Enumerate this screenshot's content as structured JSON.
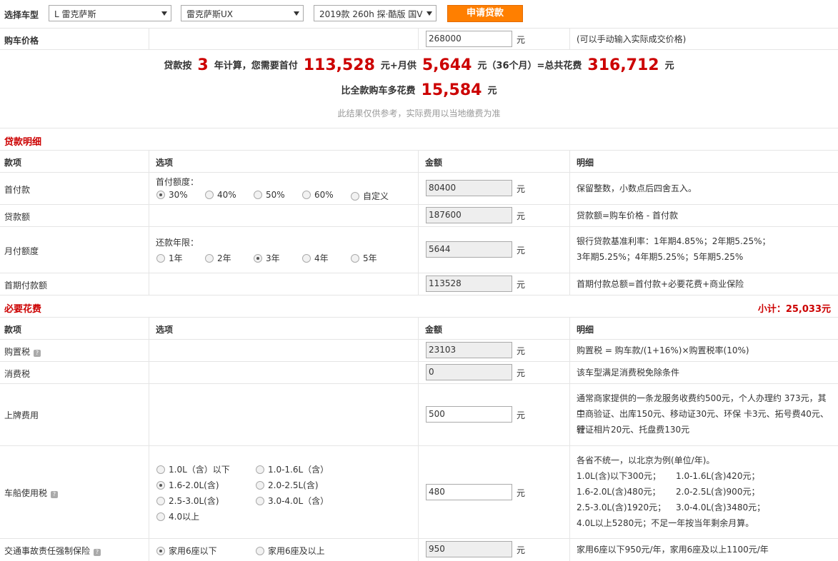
{
  "topbar": {
    "label": "选择车型",
    "brand": "L 雷克萨斯",
    "series": "雷克萨斯UX",
    "model": "2019款 260h 探·酷版 国V",
    "apply_button": "申请贷款"
  },
  "price_row": {
    "label": "购车价格",
    "value": "268000",
    "unit": "元",
    "hint": "(可以手动输入实际成交价格)"
  },
  "summary": {
    "p1": "贷款按",
    "years": "3",
    "p2": "年计算，您需要首付",
    "down": "113,528",
    "p3": "元+月供",
    "monthly": "5,644",
    "p4": "元（36个月）=总共花费",
    "total": "316,712",
    "p5": "元",
    "extra_label": "比全款购车多花费",
    "extra": "15,584",
    "extra_unit": "元",
    "note": "此结果仅供参考，实际费用以当地缴费为准"
  },
  "loan": {
    "title": "贷款明细",
    "headers": [
      "款项",
      "选项",
      "金额",
      "明细"
    ],
    "down_label": "首付款",
    "down_options_label": "首付额度：",
    "down_options": [
      "30%",
      "40%",
      "50%",
      "60%",
      "自定义"
    ],
    "down_value": "80400",
    "down_detail": "保留整数，小数点后四舍五入。",
    "loan_label": "贷款额",
    "loan_value": "187600",
    "loan_detail": "贷款额=购车价格 - 首付款",
    "monthly_label": "月付额度",
    "term_label": "还款年限：",
    "terms": [
      "1年",
      "2年",
      "3年",
      "4年",
      "5年"
    ],
    "monthly_value": "5644",
    "monthly_detail_1": "银行贷款基准利率：1年期4.85%；2年期5.25%；",
    "monthly_detail_2": "3年期5.25%；4年期5.25%；5年期5.25%",
    "first_label": "首期付款额",
    "first_value": "113528",
    "first_detail": "首期付款总额=首付款+必要花费+商业保险",
    "unit": "元"
  },
  "required": {
    "title": "必要花费",
    "subtotal": "小计：25,033元",
    "headers": [
      "款项",
      "选项",
      "金额",
      "明细"
    ],
    "purchase_tax_label": "购置税",
    "purchase_tax_value": "23103",
    "purchase_tax_detail": "购置税 = 购车款/(1+16%)×购置税率(10%)",
    "consumption_tax_label": "消费税",
    "consumption_tax_value": "0",
    "consumption_tax_detail": "该车型满足消费税免除条件",
    "plate_label": "上牌费用",
    "plate_value": "500",
    "plate_detail_1": "通常商家提供的一条龙服务收费约500元，个人办理约 373元，其中",
    "plate_detail_2": "工商验证、出库150元、移动证30元、环保 卡3元、拓号费40元、行",
    "plate_detail_3": "驶证相片20元、托盘费130元",
    "vessel_label": "车船使用税",
    "vessel_options": [
      "1.0L（含）以下",
      "1.0-1.6L（含）",
      "1.6-2.0L(含)",
      "2.0-2.5L(含)",
      "2.5-3.0L(含)",
      "3.0-4.0L（含）",
      "4.0以上"
    ],
    "vessel_value": "480",
    "vessel_detail": [
      "各省不统一，以北京为例(单位/年)。",
      "1.0L(含)以下300元；",
      "1.0-1.6L(含)420元；",
      "1.6-2.0L(含)480元；",
      "2.0-2.5L(含)900元；",
      "2.5-3.0L(含)1920元；",
      "3.0-4.0L(含)3480元；",
      "4.0L以上5280元；不足一年按当年剩余月算。"
    ],
    "insurance_label": "交通事故责任强制保险",
    "insurance_options": [
      "家用6座以下",
      "家用6座及以上"
    ],
    "insurance_value": "950",
    "insurance_detail": "家用6座以下950元/年，家用6座及以上1100元/年",
    "unit": "元",
    "help_icon": "?"
  }
}
